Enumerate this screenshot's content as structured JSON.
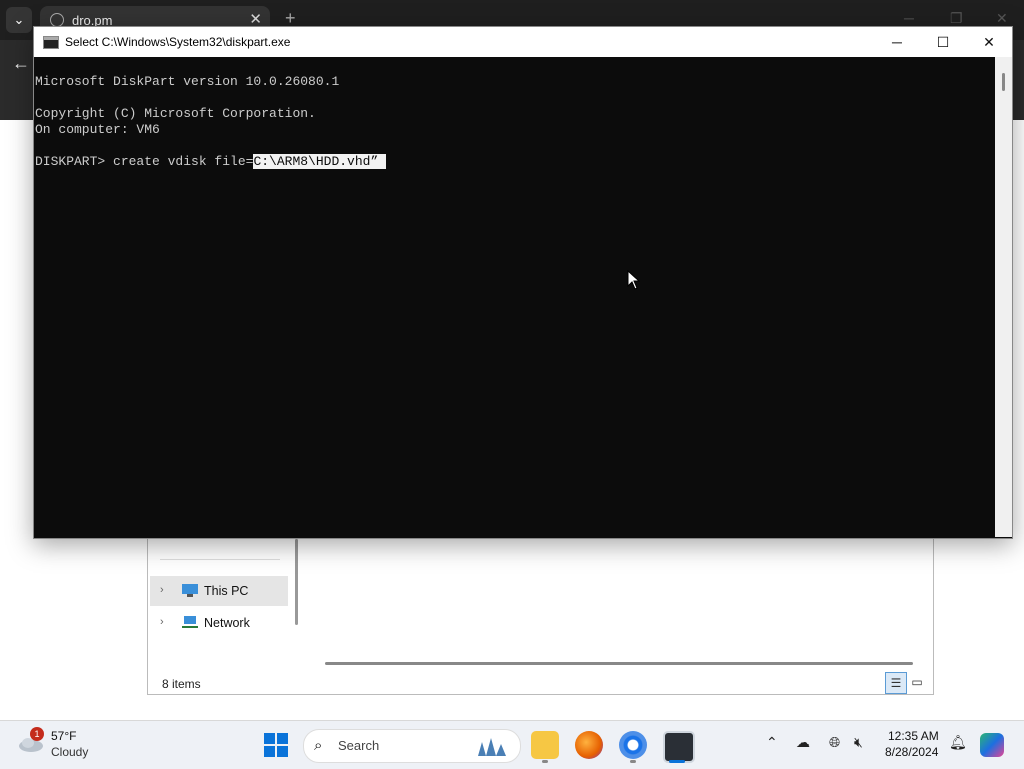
{
  "browser": {
    "tab_title": "dro.pm",
    "tab_close": "✕",
    "new_tab": "+",
    "back": "←"
  },
  "explorer": {
    "nav_items": [
      {
        "label": "This PC"
      },
      {
        "label": "Network"
      }
    ],
    "status": "8 items"
  },
  "console": {
    "title": "Select C:\\Windows\\System32\\diskpart.exe",
    "lines": [
      "Microsoft DiskPart version 10.0.26080.1",
      "Copyright (C) Microsoft Corporation.",
      "On computer: VM6",
      "DISKPART> create vdisk file=",
      "C:\\ARM8\\HDD.vhd” "
    ],
    "controls": {
      "minimize": "─",
      "maximize": "☐",
      "close": "✕"
    }
  },
  "taskbar": {
    "weather": {
      "temp": "57°F",
      "condition": "Cloudy",
      "badge": "1"
    },
    "search_placeholder": "Search",
    "clock": {
      "time": "12:35 AM",
      "date": "8/28/2024"
    }
  },
  "colors": {
    "accent": "#0a73d9",
    "console_bg": "#0c0c0c",
    "console_fg": "#cccccc"
  }
}
